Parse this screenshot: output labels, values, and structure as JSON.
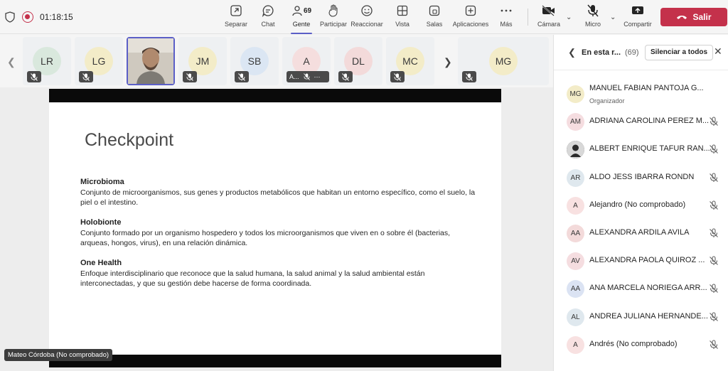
{
  "topbar": {
    "timer": "01:18:15",
    "buttons": {
      "separar": "Separar",
      "chat": "Chat",
      "gente": "Gente",
      "gente_count": "69",
      "participar": "Participar",
      "reaccionar": "Reaccionar",
      "vista": "Vista",
      "salas": "Salas",
      "aplicaciones": "Aplicaciones",
      "mas": "Más",
      "camara": "Cámara",
      "micro": "Micro",
      "compartir": "Compartir"
    },
    "leave_label": "Salir"
  },
  "filmstrip": {
    "tiles": [
      {
        "initials": "LR",
        "color": "#d9e8dd"
      },
      {
        "initials": "LG",
        "color": "#f3ecc8"
      },
      {
        "initials": "",
        "color": "#d9d3c9"
      },
      {
        "initials": "JM",
        "color": "#f3ecc8"
      },
      {
        "initials": "SB",
        "color": "#dbe6f3"
      },
      {
        "initials": "A",
        "color": "#f5dede",
        "label": "A..."
      },
      {
        "initials": "DL",
        "color": "#f3dada"
      },
      {
        "initials": "MC",
        "color": "#f3ecc8"
      },
      {
        "initials": "MG",
        "color": "#f3ecc8"
      }
    ]
  },
  "slide": {
    "title": "Checkpoint",
    "items": [
      {
        "term": "Microbioma",
        "definition": "Conjunto de microorganismos, sus genes y productos metabólicos que habitan un entorno específico, como el suelo, la piel o el intestino."
      },
      {
        "term": "Holobionte",
        "definition": "Conjunto formado por un organismo hospedero y todos los microorganismos que viven en o sobre él (bacterias, arqueas, hongos, virus), en una relación dinámica."
      },
      {
        "term": "One Health",
        "definition": "Enfoque interdisciplinario que reconoce que la salud humana, la salud animal y la salud ambiental están interconectadas, y que su gestión debe hacerse de forma coordinada."
      }
    ]
  },
  "presenter_label": "Mateo Córdoba (No comprobado)",
  "panel": {
    "title": "En esta r...",
    "count": "(69)",
    "mute_all": "Silenciar a todos",
    "participants": [
      {
        "initials": "MG",
        "name": "MANUEL FABIAN PANTOJA G...",
        "role": "Organizador",
        "color": "#f3ecc8"
      },
      {
        "initials": "AM",
        "name": "ADRIANA CAROLINA PEREZ M...",
        "color": "#f5dde0"
      },
      {
        "initials": "",
        "name": "ALBERT ENRIQUE TAFUR RAN...",
        "color": "#3a3a3a"
      },
      {
        "initials": "AR",
        "name": "ALDO JESS IBARRA RONDN",
        "color": "#dfe8ee"
      },
      {
        "initials": "A",
        "name": "Alejandro (No comprobado)",
        "color": "#f8e1e1"
      },
      {
        "initials": "AA",
        "name": "ALEXANDRA ARDILA AVILA",
        "color": "#f3dada"
      },
      {
        "initials": "AV",
        "name": "ALEXANDRA PAOLA QUIROZ ...",
        "color": "#f5dde0"
      },
      {
        "initials": "AA",
        "name": "ANA MARCELA NORIEGA ARR...",
        "color": "#dbe3f3"
      },
      {
        "initials": "AL",
        "name": "ANDREA JULIANA HERNANDE...",
        "color": "#dfe8ee"
      },
      {
        "initials": "A",
        "name": "Andrés (No comprobado)",
        "color": "#f8e1e1"
      }
    ]
  }
}
